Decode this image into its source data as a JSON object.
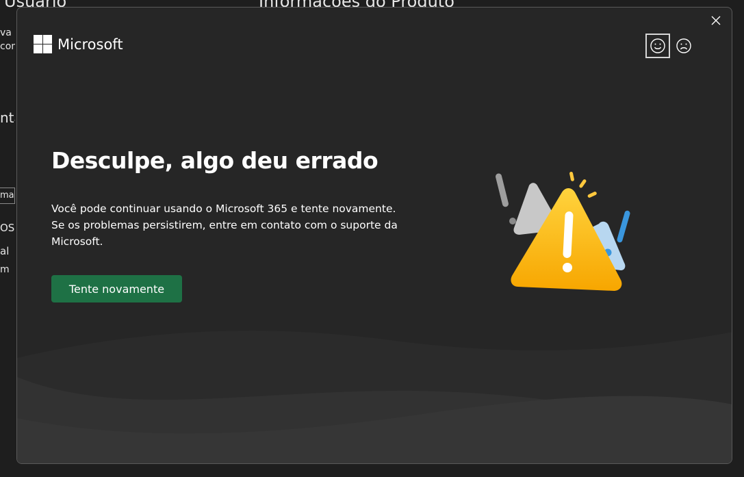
{
  "background": {
    "heading_user": "Usuário",
    "heading_product": "Informações do Produto",
    "line1": "va",
    "line2": "com",
    "heading_account": "nta",
    "input_text": "ma",
    "line3": "OS:",
    "line4": "al",
    "line5": "m"
  },
  "dialog": {
    "logo_text": "Microsoft",
    "title": "Desculpe, algo deu errado",
    "message_line1": "Você pode continuar usando o Microsoft 365 e tente novamente.",
    "message_line2": "Se os problemas persistirem, entre em contato com o suporte da Microsoft.",
    "retry_label": "Tente novamente",
    "feedback": {
      "smile_icon": "smile-icon",
      "frown_icon": "frown-icon",
      "selected": "smile"
    },
    "close_icon": "close-icon",
    "illustration_icon": "warning-triangles-icon"
  },
  "colors": {
    "dialog_bg": "#262626",
    "button_green": "#1e7145",
    "warning_yellow": "#ffb900",
    "accent_blue": "#3a96dd"
  }
}
